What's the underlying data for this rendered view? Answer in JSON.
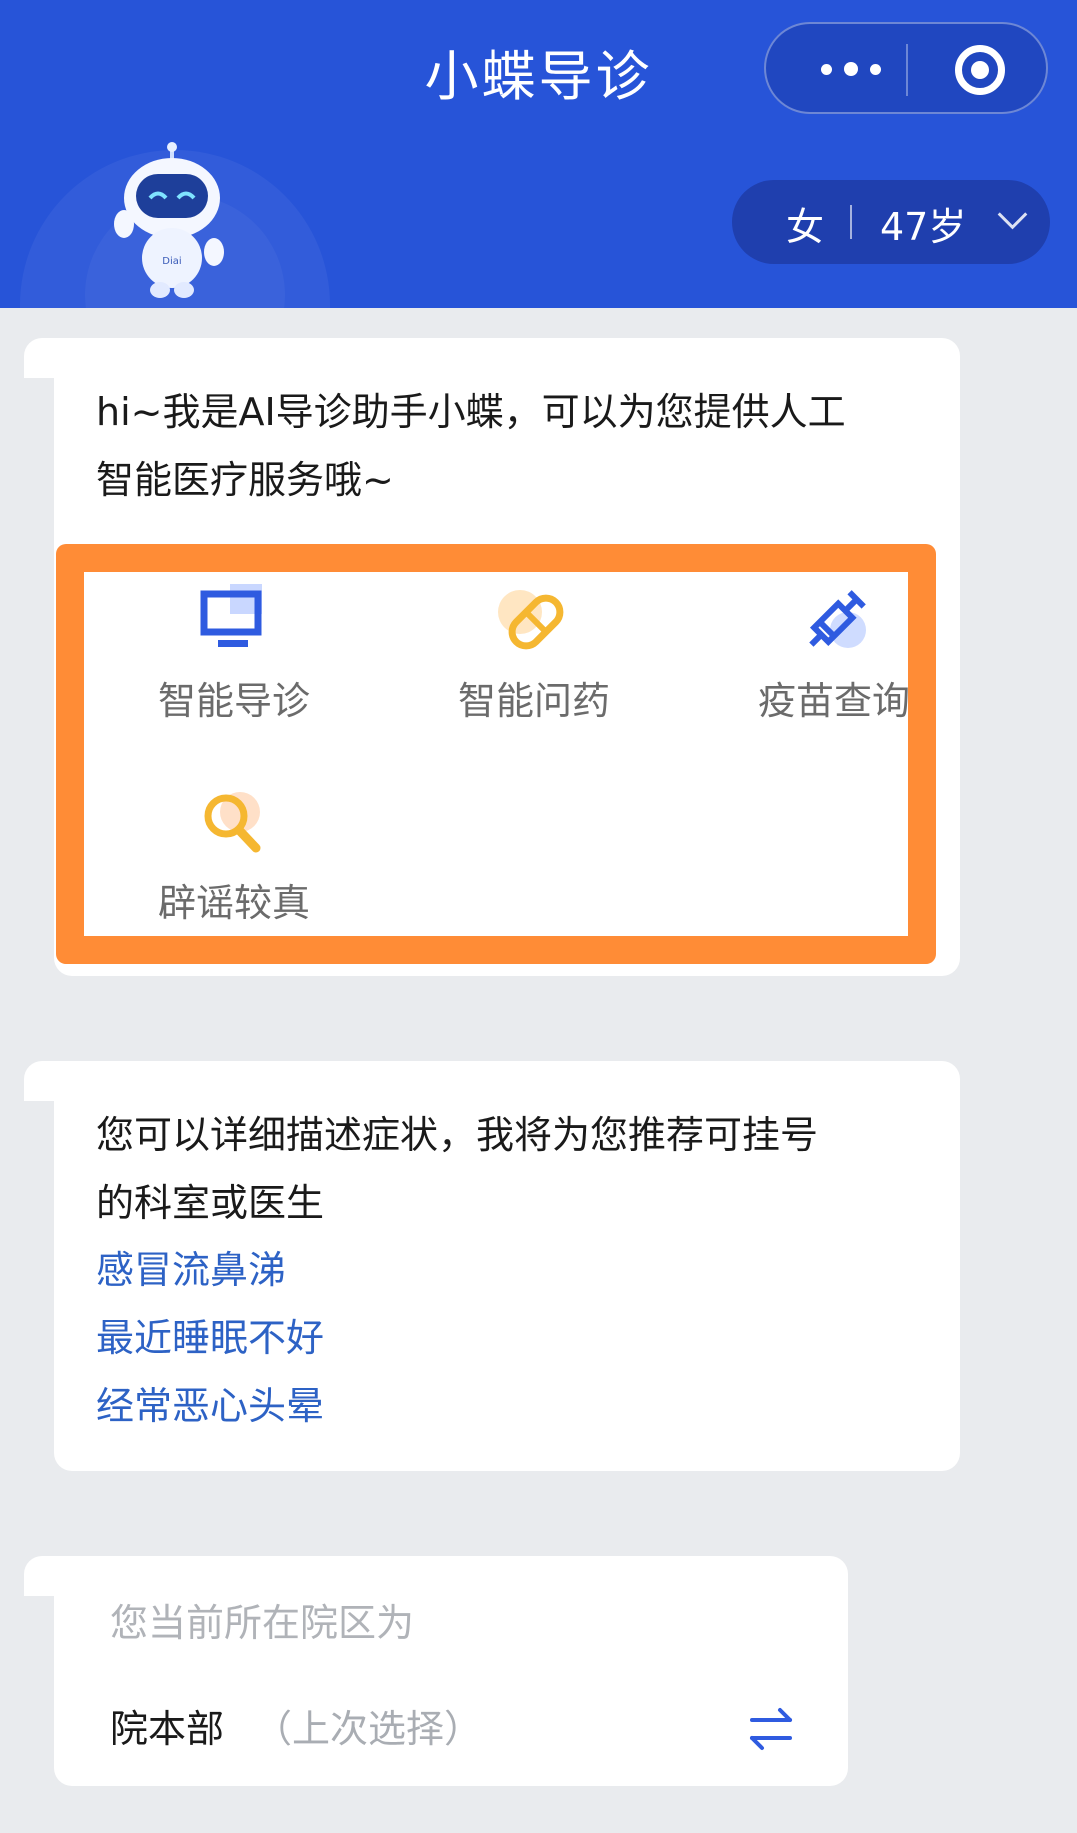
{
  "header": {
    "title": "小蝶导诊",
    "more_icon": "more-dots-icon",
    "close_icon": "target-circle-icon",
    "mascot_icon": "robot-mascot-icon",
    "bg_color": "#2754d8"
  },
  "profile": {
    "gender": "女",
    "age": "47岁",
    "chevron_icon": "chevron-down-icon"
  },
  "greeting": {
    "line1": "hi~我是AI导诊助手小蝶，可以为您提供人工",
    "line2": "智能医疗服务哦~"
  },
  "services": [
    {
      "label": "智能导诊",
      "icon": "monitor-icon"
    },
    {
      "label": "智能问药",
      "icon": "pill-icon"
    },
    {
      "label": "疫苗查询",
      "icon": "syringe-icon"
    },
    {
      "label": "辟谣较真",
      "icon": "magnifier-icon"
    }
  ],
  "symptom": {
    "line1": "您可以详细描述症状，我将为您推荐可挂号",
    "line2": "的科室或医生",
    "suggestions": [
      "感冒流鼻涕",
      "最近睡眠不好",
      "经常恶心头晕"
    ]
  },
  "campus": {
    "hint": "您当前所在院区为",
    "name": "院本部",
    "note": "（上次选择）",
    "swap_icon": "swap-arrows-icon"
  },
  "colors": {
    "accent_blue": "#2754d8",
    "highlight_orange": "#ff8c36",
    "link_blue": "#2d62c5"
  }
}
